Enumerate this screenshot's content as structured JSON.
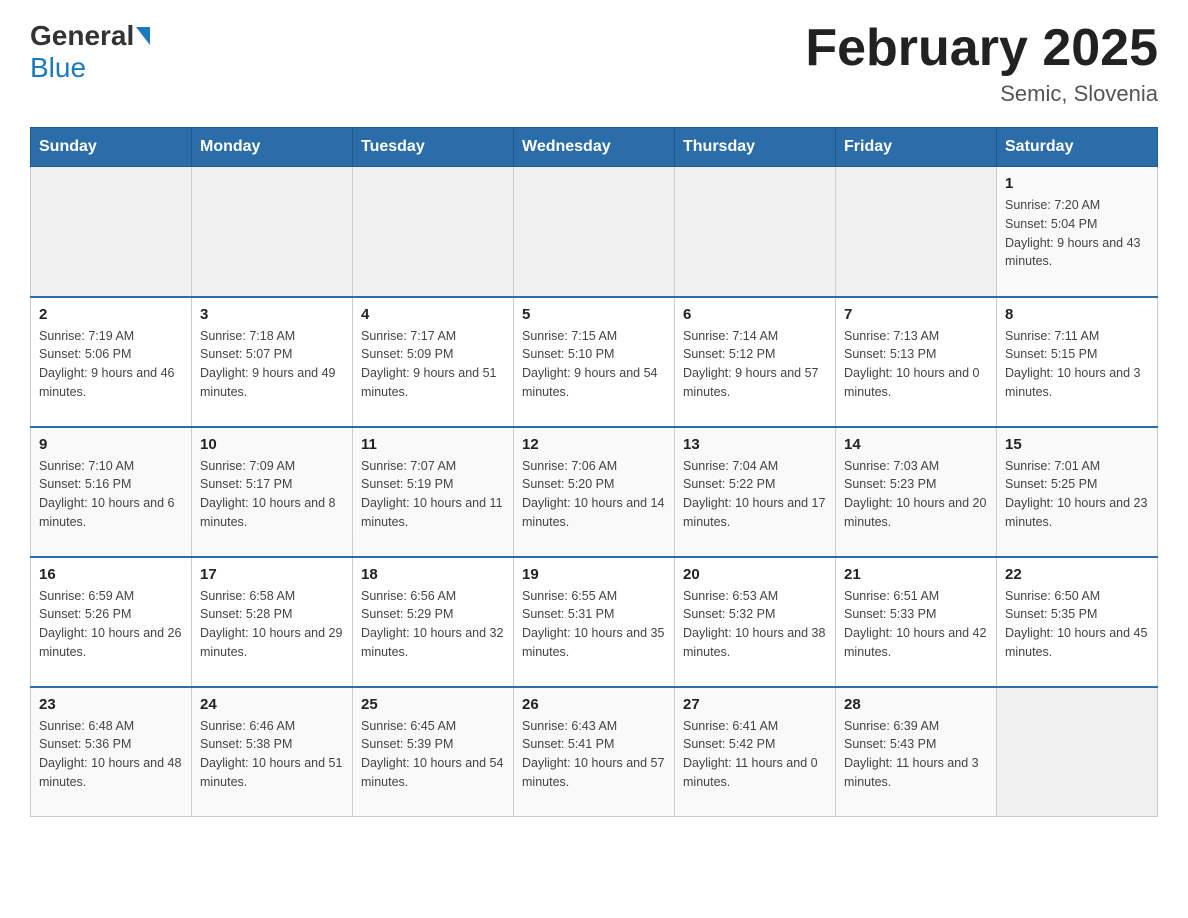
{
  "header": {
    "logo_general": "General",
    "logo_blue": "Blue",
    "title": "February 2025",
    "subtitle": "Semic, Slovenia"
  },
  "days_of_week": [
    "Sunday",
    "Monday",
    "Tuesday",
    "Wednesday",
    "Thursday",
    "Friday",
    "Saturday"
  ],
  "weeks": [
    [
      {
        "day": "",
        "info": ""
      },
      {
        "day": "",
        "info": ""
      },
      {
        "day": "",
        "info": ""
      },
      {
        "day": "",
        "info": ""
      },
      {
        "day": "",
        "info": ""
      },
      {
        "day": "",
        "info": ""
      },
      {
        "day": "1",
        "info": "Sunrise: 7:20 AM\nSunset: 5:04 PM\nDaylight: 9 hours and 43 minutes."
      }
    ],
    [
      {
        "day": "2",
        "info": "Sunrise: 7:19 AM\nSunset: 5:06 PM\nDaylight: 9 hours and 46 minutes."
      },
      {
        "day": "3",
        "info": "Sunrise: 7:18 AM\nSunset: 5:07 PM\nDaylight: 9 hours and 49 minutes."
      },
      {
        "day": "4",
        "info": "Sunrise: 7:17 AM\nSunset: 5:09 PM\nDaylight: 9 hours and 51 minutes."
      },
      {
        "day": "5",
        "info": "Sunrise: 7:15 AM\nSunset: 5:10 PM\nDaylight: 9 hours and 54 minutes."
      },
      {
        "day": "6",
        "info": "Sunrise: 7:14 AM\nSunset: 5:12 PM\nDaylight: 9 hours and 57 minutes."
      },
      {
        "day": "7",
        "info": "Sunrise: 7:13 AM\nSunset: 5:13 PM\nDaylight: 10 hours and 0 minutes."
      },
      {
        "day": "8",
        "info": "Sunrise: 7:11 AM\nSunset: 5:15 PM\nDaylight: 10 hours and 3 minutes."
      }
    ],
    [
      {
        "day": "9",
        "info": "Sunrise: 7:10 AM\nSunset: 5:16 PM\nDaylight: 10 hours and 6 minutes."
      },
      {
        "day": "10",
        "info": "Sunrise: 7:09 AM\nSunset: 5:17 PM\nDaylight: 10 hours and 8 minutes."
      },
      {
        "day": "11",
        "info": "Sunrise: 7:07 AM\nSunset: 5:19 PM\nDaylight: 10 hours and 11 minutes."
      },
      {
        "day": "12",
        "info": "Sunrise: 7:06 AM\nSunset: 5:20 PM\nDaylight: 10 hours and 14 minutes."
      },
      {
        "day": "13",
        "info": "Sunrise: 7:04 AM\nSunset: 5:22 PM\nDaylight: 10 hours and 17 minutes."
      },
      {
        "day": "14",
        "info": "Sunrise: 7:03 AM\nSunset: 5:23 PM\nDaylight: 10 hours and 20 minutes."
      },
      {
        "day": "15",
        "info": "Sunrise: 7:01 AM\nSunset: 5:25 PM\nDaylight: 10 hours and 23 minutes."
      }
    ],
    [
      {
        "day": "16",
        "info": "Sunrise: 6:59 AM\nSunset: 5:26 PM\nDaylight: 10 hours and 26 minutes."
      },
      {
        "day": "17",
        "info": "Sunrise: 6:58 AM\nSunset: 5:28 PM\nDaylight: 10 hours and 29 minutes."
      },
      {
        "day": "18",
        "info": "Sunrise: 6:56 AM\nSunset: 5:29 PM\nDaylight: 10 hours and 32 minutes."
      },
      {
        "day": "19",
        "info": "Sunrise: 6:55 AM\nSunset: 5:31 PM\nDaylight: 10 hours and 35 minutes."
      },
      {
        "day": "20",
        "info": "Sunrise: 6:53 AM\nSunset: 5:32 PM\nDaylight: 10 hours and 38 minutes."
      },
      {
        "day": "21",
        "info": "Sunrise: 6:51 AM\nSunset: 5:33 PM\nDaylight: 10 hours and 42 minutes."
      },
      {
        "day": "22",
        "info": "Sunrise: 6:50 AM\nSunset: 5:35 PM\nDaylight: 10 hours and 45 minutes."
      }
    ],
    [
      {
        "day": "23",
        "info": "Sunrise: 6:48 AM\nSunset: 5:36 PM\nDaylight: 10 hours and 48 minutes."
      },
      {
        "day": "24",
        "info": "Sunrise: 6:46 AM\nSunset: 5:38 PM\nDaylight: 10 hours and 51 minutes."
      },
      {
        "day": "25",
        "info": "Sunrise: 6:45 AM\nSunset: 5:39 PM\nDaylight: 10 hours and 54 minutes."
      },
      {
        "day": "26",
        "info": "Sunrise: 6:43 AM\nSunset: 5:41 PM\nDaylight: 10 hours and 57 minutes."
      },
      {
        "day": "27",
        "info": "Sunrise: 6:41 AM\nSunset: 5:42 PM\nDaylight: 11 hours and 0 minutes."
      },
      {
        "day": "28",
        "info": "Sunrise: 6:39 AM\nSunset: 5:43 PM\nDaylight: 11 hours and 3 minutes."
      },
      {
        "day": "",
        "info": ""
      }
    ]
  ]
}
